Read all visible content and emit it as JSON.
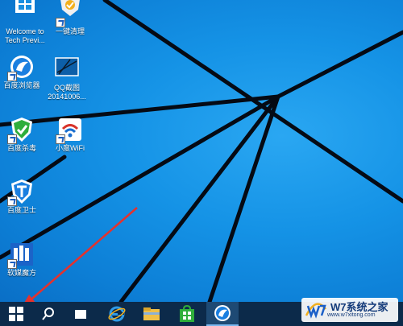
{
  "desktop_icons": [
    {
      "label": "Welcome to\nTech Previ...",
      "icon": "windows-tile-icon"
    },
    {
      "label": "一键清理",
      "icon": "cleanup-shield-icon"
    },
    {
      "label": "百度浏览器",
      "icon": "baidu-browser-icon"
    },
    {
      "label": "QQ截图\n20141006...",
      "icon": "screenshot-image-icon"
    },
    {
      "label": "百度杀毒",
      "icon": "baidu-antivirus-icon"
    },
    {
      "label": "小度WiFi",
      "icon": "wifi-icon"
    },
    {
      "label": "百度卫士",
      "icon": "baidu-guard-icon"
    },
    {
      "label": "软媒魔方",
      "icon": "ruanmei-cube-icon"
    }
  ],
  "taskbar": {
    "items": [
      "start-icon",
      "search-icon",
      "task-view-icon",
      "internet-explorer-icon",
      "file-explorer-icon",
      "store-icon",
      "baidu-browser-icon"
    ]
  },
  "watermark": {
    "brand": "W7系统之家",
    "url": "www.w7xitong.com"
  },
  "colors": {
    "wallpaper": "#1593e6",
    "taskbar": "#0c2a4a",
    "arrow": "#e5322d"
  }
}
